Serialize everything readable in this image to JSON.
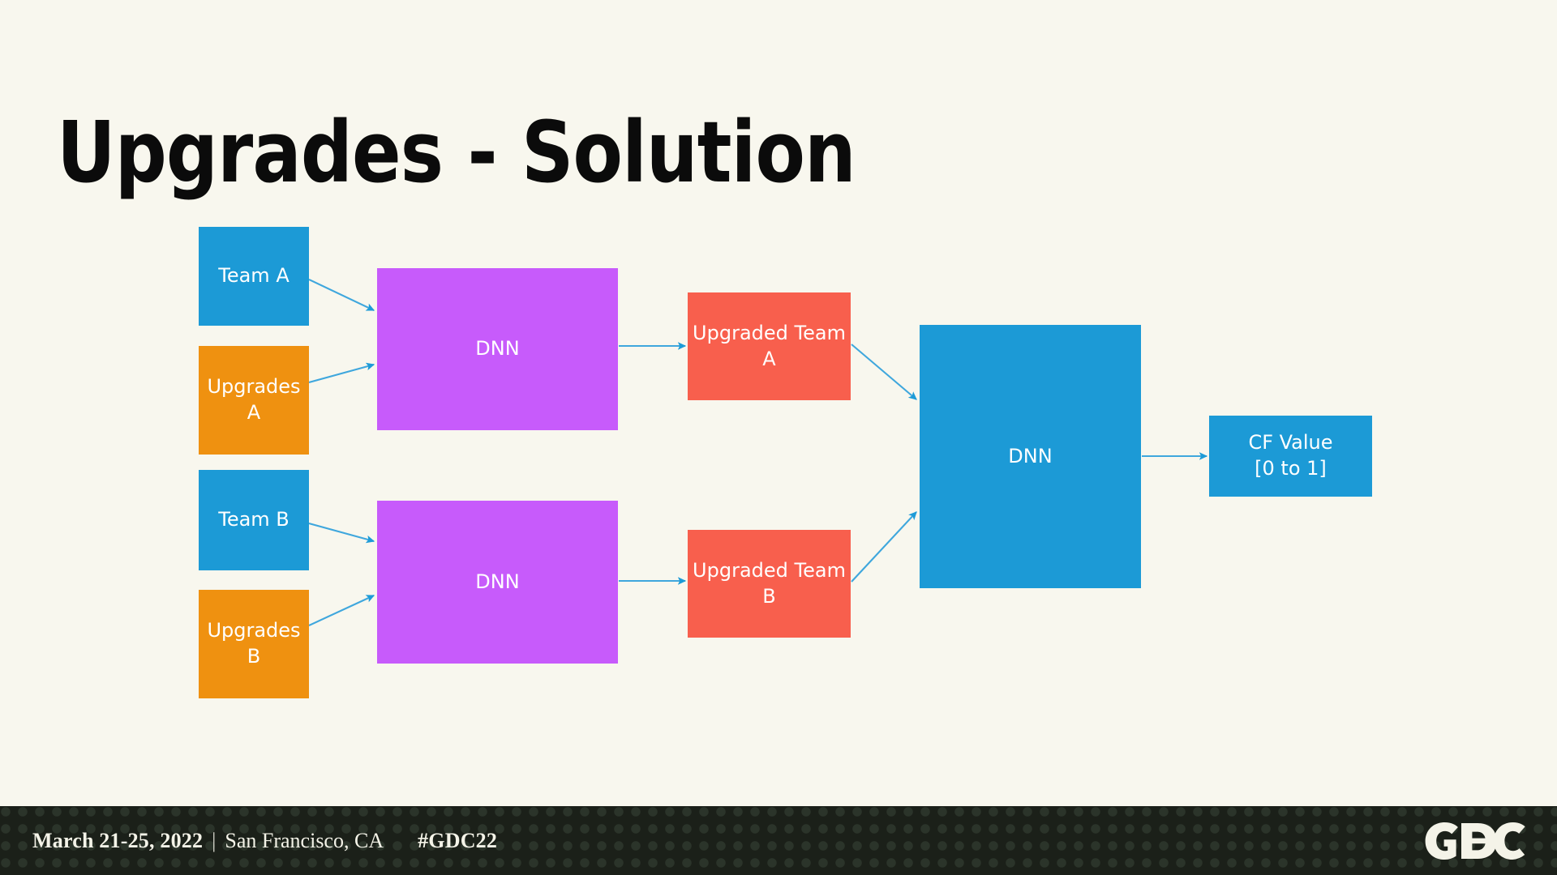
{
  "slide": {
    "title": "Upgrades - Solution",
    "background_color": "#f8f7ee"
  },
  "colors": {
    "blue": "#1c9ad6",
    "orange": "#ef9110",
    "purple": "#c75bfb",
    "red": "#f85f4d",
    "arrow": "#1d9bd7",
    "title_text": "#0b0b0b",
    "node_text": "#ffffff",
    "footer_bg": "#1b2019",
    "footer_text": "#f4f3e8"
  },
  "diagram": {
    "nodes": {
      "team_a": "Team A",
      "upgrades_a": "Upgrades\nA",
      "team_b": "Team B",
      "upgrades_b": "Upgrades\nB",
      "dnn_a": "DNN",
      "dnn_b": "DNN",
      "upgraded_team_a": "Upgraded Team\nA",
      "upgraded_team_b": "Upgraded Team\nB",
      "dnn_final": "DNN",
      "cf_value": "CF Value\n[0 to 1]"
    },
    "edges": [
      {
        "from": "team_a",
        "to": "dnn_a"
      },
      {
        "from": "upgrades_a",
        "to": "dnn_a"
      },
      {
        "from": "dnn_a",
        "to": "upgraded_team_a"
      },
      {
        "from": "team_b",
        "to": "dnn_b"
      },
      {
        "from": "upgrades_b",
        "to": "dnn_b"
      },
      {
        "from": "dnn_b",
        "to": "upgraded_team_b"
      },
      {
        "from": "upgraded_team_a",
        "to": "dnn_final"
      },
      {
        "from": "upgraded_team_b",
        "to": "dnn_final"
      },
      {
        "from": "dnn_final",
        "to": "cf_value"
      }
    ]
  },
  "footer": {
    "date": "March 21-25, 2022",
    "separator": "|",
    "city": "San Francisco, CA",
    "hashtag": "#GDC22",
    "logo_text": "GDC"
  }
}
